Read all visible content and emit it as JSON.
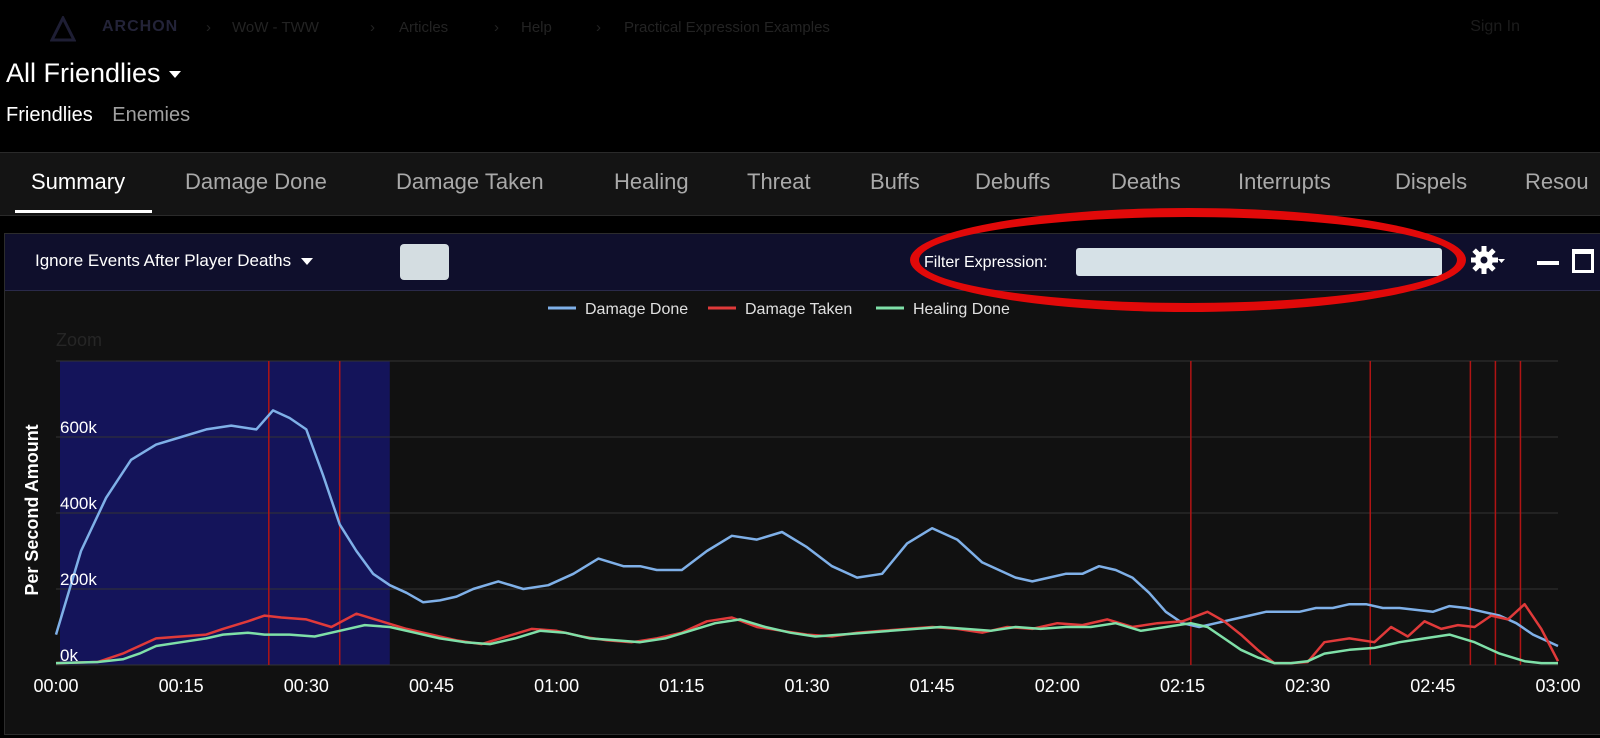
{
  "topnav": {
    "brand": "ARCHON",
    "breadcrumbs": [
      "WoW - TWW",
      "Articles",
      "Help",
      "Practical Expression Examples"
    ],
    "sign_in": "Sign In"
  },
  "header": {
    "title": "All Friendlies",
    "subtabs": [
      "Friendlies",
      "Enemies"
    ]
  },
  "tabs": [
    "Summary",
    "Damage Done",
    "Damage Taken",
    "Healing",
    "Threat",
    "Buffs",
    "Debuffs",
    "Deaths",
    "Interrupts",
    "Dispels",
    "Resou"
  ],
  "panel": {
    "ignore_label": "Ignore Events After Player Deaths",
    "filter_label": "Filter Expression:",
    "filter_value": ""
  },
  "colors": {
    "damage_done": "#7fb0e8",
    "damage_taken": "#e03a3a",
    "healing_done": "#7fe0a8",
    "death_line": "#b01414",
    "selection": "#14145a",
    "annotation": "#e10909"
  },
  "chart_data": {
    "type": "line",
    "zoom_label": "Zoom",
    "ylabel": "Per Second Amount",
    "yticks": [
      "0k",
      "200k",
      "400k",
      "600k"
    ],
    "xticks": [
      "00:00",
      "00:15",
      "00:30",
      "00:45",
      "01:00",
      "01:15",
      "01:30",
      "01:45",
      "02:00",
      "02:15",
      "02:30",
      "02:45",
      "03:00"
    ],
    "ylim": [
      0,
      800000
    ],
    "xlim": [
      0,
      180
    ],
    "selection_range": [
      0,
      40
    ],
    "death_markers": [
      25.5,
      34,
      136,
      157.5,
      169.5,
      172.5,
      175.5
    ],
    "series": [
      {
        "name": "Damage Done",
        "x": [
          0,
          3,
          6,
          9,
          12,
          15,
          18,
          21,
          24,
          26,
          28,
          30,
          32,
          34,
          36,
          38,
          40,
          42,
          44,
          46,
          48,
          50,
          53,
          56,
          59,
          62,
          65,
          68,
          70,
          72,
          75,
          78,
          81,
          84,
          87,
          90,
          93,
          96,
          99,
          102,
          105,
          108,
          111,
          113,
          115,
          117,
          119,
          121,
          123,
          125,
          127,
          129,
          131,
          133,
          135,
          137,
          139,
          141,
          143,
          145,
          147,
          149,
          151,
          153,
          155,
          157,
          159,
          161,
          163,
          165,
          167,
          169,
          171,
          173,
          175,
          177,
          180
        ],
        "y": [
          80000,
          300000,
          440000,
          540000,
          580000,
          600000,
          620000,
          630000,
          620000,
          670000,
          650000,
          620000,
          500000,
          370000,
          300000,
          240000,
          210000,
          190000,
          165000,
          170000,
          180000,
          200000,
          220000,
          200000,
          210000,
          240000,
          280000,
          260000,
          260000,
          250000,
          250000,
          300000,
          340000,
          330000,
          350000,
          310000,
          260000,
          230000,
          240000,
          320000,
          360000,
          330000,
          270000,
          250000,
          230000,
          220000,
          230000,
          240000,
          240000,
          260000,
          250000,
          230000,
          190000,
          140000,
          110000,
          100000,
          110000,
          120000,
          130000,
          140000,
          140000,
          140000,
          150000,
          150000,
          160000,
          160000,
          150000,
          150000,
          145000,
          140000,
          155000,
          150000,
          140000,
          130000,
          110000,
          80000,
          50000
        ]
      },
      {
        "name": "Damage Taken",
        "x": [
          0,
          5,
          8,
          10,
          12,
          15,
          18,
          20,
          23,
          25,
          27,
          30,
          33,
          36,
          39,
          42,
          45,
          48,
          51,
          54,
          57,
          60,
          63,
          66,
          69,
          72,
          75,
          78,
          81,
          84,
          87,
          90,
          93,
          96,
          99,
          102,
          105,
          108,
          111,
          114,
          117,
          120,
          123,
          126,
          129,
          132,
          135,
          138,
          140,
          142,
          144,
          146,
          148,
          150,
          152,
          155,
          158,
          160,
          162,
          164,
          166,
          168,
          170,
          172,
          174,
          176,
          178,
          180
        ],
        "y": [
          5000,
          8000,
          30000,
          50000,
          70000,
          75000,
          80000,
          95000,
          115000,
          130000,
          125000,
          120000,
          100000,
          135000,
          115000,
          95000,
          80000,
          65000,
          55000,
          75000,
          95000,
          90000,
          75000,
          65000,
          60000,
          70000,
          85000,
          115000,
          125000,
          100000,
          90000,
          80000,
          75000,
          85000,
          90000,
          95000,
          100000,
          95000,
          85000,
          100000,
          95000,
          110000,
          105000,
          120000,
          100000,
          110000,
          115000,
          140000,
          115000,
          80000,
          40000,
          5000,
          5000,
          8000,
          60000,
          70000,
          60000,
          100000,
          75000,
          115000,
          95000,
          105000,
          100000,
          130000,
          120000,
          160000,
          95000,
          10000
        ]
      },
      {
        "name": "Healing Done",
        "x": [
          0,
          5,
          8,
          10,
          12,
          15,
          18,
          20,
          23,
          25,
          28,
          31,
          34,
          37,
          40,
          43,
          46,
          49,
          52,
          55,
          58,
          61,
          64,
          67,
          70,
          73,
          76,
          79,
          82,
          85,
          88,
          91,
          94,
          97,
          100,
          103,
          106,
          109,
          112,
          115,
          118,
          121,
          124,
          127,
          130,
          133,
          136,
          138,
          140,
          142,
          144,
          146,
          148,
          150,
          152,
          155,
          158,
          161,
          164,
          167,
          170,
          173,
          176,
          178,
          180
        ],
        "y": [
          5000,
          8000,
          15000,
          30000,
          50000,
          60000,
          70000,
          80000,
          85000,
          80000,
          80000,
          75000,
          90000,
          105000,
          100000,
          85000,
          70000,
          60000,
          55000,
          70000,
          90000,
          85000,
          70000,
          65000,
          60000,
          70000,
          90000,
          110000,
          120000,
          100000,
          85000,
          75000,
          80000,
          85000,
          90000,
          95000,
          100000,
          95000,
          90000,
          100000,
          95000,
          100000,
          100000,
          110000,
          90000,
          100000,
          110000,
          100000,
          70000,
          40000,
          20000,
          5000,
          5000,
          10000,
          30000,
          40000,
          45000,
          60000,
          70000,
          80000,
          60000,
          30000,
          10000,
          5000,
          5000
        ]
      }
    ]
  }
}
